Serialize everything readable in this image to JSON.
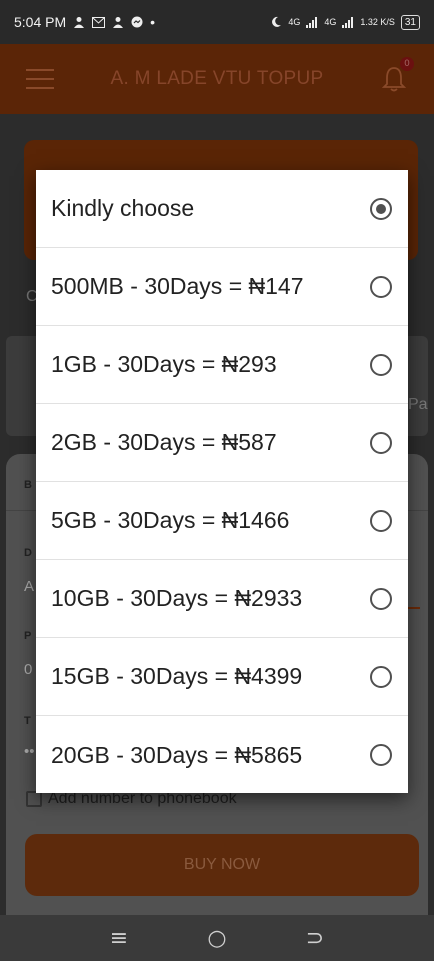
{
  "status_bar": {
    "time": "5:04 PM",
    "left_icons": [
      "person-icon",
      "mail-icon",
      "person-icon",
      "messenger-icon",
      "dot-icon"
    ],
    "network1": "4G",
    "network2": "4G",
    "speed": "1.32 K/S",
    "battery": "31"
  },
  "app_bar": {
    "title": "A. M LADE VTU TOPUP",
    "notification_count": "0"
  },
  "background": {
    "side_letter_c": "C",
    "side_text_pa": "Pa",
    "sheet_labels": [
      "B",
      "D",
      "A",
      "P",
      "0",
      "T",
      "••"
    ],
    "phonebook_label": "Add number to phonebook",
    "buy_label": "BUY NOW"
  },
  "dialog": {
    "options": [
      {
        "label": "Kindly choose",
        "selected": true
      },
      {
        "label": "500MB - 30Days = ₦147",
        "selected": false
      },
      {
        "label": "1GB - 30Days = ₦293",
        "selected": false
      },
      {
        "label": "2GB - 30Days = ₦587",
        "selected": false
      },
      {
        "label": "5GB - 30Days = ₦1466",
        "selected": false
      },
      {
        "label": "10GB - 30Days = ₦2933",
        "selected": false
      },
      {
        "label": "15GB - 30Days = ₦4399",
        "selected": false
      },
      {
        "label": "20GB - 30Days = ₦5865",
        "selected": false
      }
    ]
  },
  "nav_bar": {
    "recents": "≡",
    "home": "○",
    "back": "⊃"
  },
  "colors": {
    "accent": "#5b2507",
    "scrim": "#2c2c2c",
    "dialog_bg": "#ffffff"
  }
}
